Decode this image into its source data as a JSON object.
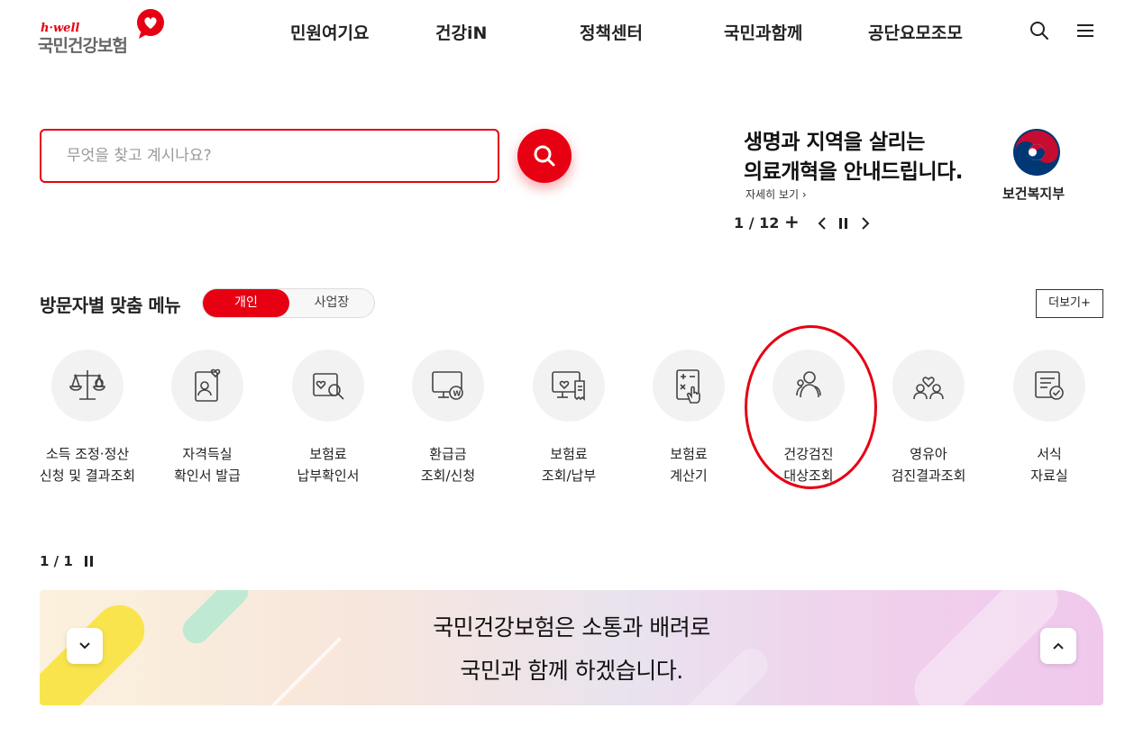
{
  "header": {
    "logo_brand": "h·well",
    "logo_text": "국민건강보험",
    "nav": [
      "민원여기요",
      "건강iN",
      "정책센터",
      "국민과함께",
      "공단요모조모"
    ],
    "search_icon": "search-icon",
    "menu_icon": "hamburger-menu-icon"
  },
  "search": {
    "placeholder": "무엇을 찾고 계시나요?",
    "value": ""
  },
  "banner": {
    "title": "생명과 지역을 살리는\n의료개혁을 안내드립니다.",
    "more_label": "자세히 보기 ›",
    "org_name": "보건복지부",
    "counter": "1 / 12",
    "plus": "+"
  },
  "visitor_menu": {
    "title": "방문자별 맞춤 메뉴",
    "tabs": [
      "개인",
      "사업장"
    ],
    "active_tab": "개인",
    "more_label": "더보기+",
    "items": [
      {
        "label": "소득 조정·정산\n신청 및 결과조회",
        "icon": "scale-icon"
      },
      {
        "label": "자격득실\n확인서 발급",
        "icon": "id-certificate-icon"
      },
      {
        "label": "보험료\n납부확인서",
        "icon": "document-search-icon"
      },
      {
        "label": "환급금\n조회/신청",
        "icon": "monitor-refund-icon"
      },
      {
        "label": "보험료\n조회/납부",
        "icon": "monitor-receipt-icon"
      },
      {
        "label": "보험료\n계산기",
        "icon": "calculator-icon"
      },
      {
        "label": "건강검진\n대상조회",
        "icon": "people-checkup-icon"
      },
      {
        "label": "영유아\n검진결과조회",
        "icon": "family-heart-icon"
      },
      {
        "label": "서식\n자료실",
        "icon": "form-library-icon"
      }
    ],
    "pager": "1 / 1"
  },
  "bottom_banner": {
    "text": "국민건강보험은 소통과 배려로\n국민과 함께 하겠습니다."
  },
  "colors": {
    "accent": "#e60012",
    "text": "#222222",
    "icon_bg": "#f2f2f2"
  }
}
